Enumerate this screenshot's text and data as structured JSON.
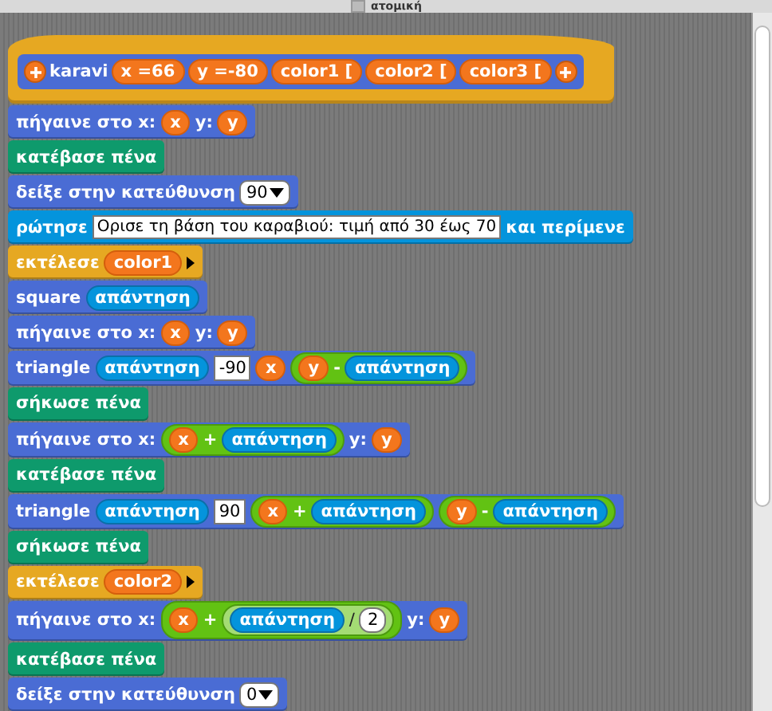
{
  "header": {
    "title": "ατομική"
  },
  "script": {
    "definition": {
      "color": "#e6a822",
      "name": "karavi",
      "params": [
        "x =66",
        "y =-80",
        "color1 [",
        "color2 [",
        "color3 ["
      ]
    },
    "blocks": [
      {
        "color": "#4a6cd4",
        "parts": [
          {
            "kind": "label",
            "text": "πήγαινε στο x:"
          },
          {
            "kind": "var",
            "text": "x"
          },
          {
            "kind": "label",
            "text": "y:"
          },
          {
            "kind": "var",
            "text": "y"
          }
        ]
      },
      {
        "color": "#0e9a6c",
        "parts": [
          {
            "kind": "label",
            "text": "κατέβασε πένα"
          }
        ]
      },
      {
        "color": "#4a6cd4",
        "parts": [
          {
            "kind": "label",
            "text": "δείξε στην κατεύθυνση"
          },
          {
            "kind": "dropdown",
            "text": "90"
          }
        ]
      },
      {
        "color": "#0494dc",
        "parts": [
          {
            "kind": "label",
            "text": "ρώτησε"
          },
          {
            "kind": "text",
            "text": "Ορισε τη βάση του καραβιού: τιμή από 30 έως 70"
          },
          {
            "kind": "label",
            "text": "και περίμενε"
          }
        ]
      },
      {
        "color": "#e6a822",
        "parts": [
          {
            "kind": "label",
            "text": "εκτέλεσε"
          },
          {
            "kind": "var",
            "text": "color1"
          },
          {
            "kind": "arrow"
          }
        ]
      },
      {
        "color": "#4a6cd4",
        "parts": [
          {
            "kind": "label",
            "text": "square"
          },
          {
            "kind": "reporter",
            "text": "απάντηση"
          }
        ]
      },
      {
        "color": "#4a6cd4",
        "parts": [
          {
            "kind": "label",
            "text": "πήγαινε στο x:"
          },
          {
            "kind": "var",
            "text": "x"
          },
          {
            "kind": "label",
            "text": "y:"
          },
          {
            "kind": "var",
            "text": "y"
          }
        ]
      },
      {
        "color": "#4a6cd4",
        "parts": [
          {
            "kind": "label",
            "text": "triangle"
          },
          {
            "kind": "reporter",
            "text": "απάντηση"
          },
          {
            "kind": "num",
            "text": "-90"
          },
          {
            "kind": "var",
            "text": "x"
          },
          {
            "kind": "op",
            "color": "#62c213",
            "parts": [
              {
                "kind": "var",
                "text": "y"
              },
              {
                "kind": "label",
                "text": "-"
              },
              {
                "kind": "reporter",
                "text": "απάντηση"
              }
            ]
          }
        ]
      },
      {
        "color": "#0e9a6c",
        "parts": [
          {
            "kind": "label",
            "text": "σήκωσε πένα"
          }
        ]
      },
      {
        "color": "#4a6cd4",
        "parts": [
          {
            "kind": "label",
            "text": "πήγαινε στο x:"
          },
          {
            "kind": "op",
            "color": "#62c213",
            "parts": [
              {
                "kind": "var",
                "text": "x"
              },
              {
                "kind": "label",
                "text": "+"
              },
              {
                "kind": "reporter",
                "text": "απάντηση"
              }
            ]
          },
          {
            "kind": "label",
            "text": "y:"
          },
          {
            "kind": "var",
            "text": "y"
          }
        ]
      },
      {
        "color": "#0e9a6c",
        "parts": [
          {
            "kind": "label",
            "text": "κατέβασε πένα"
          }
        ]
      },
      {
        "color": "#4a6cd4",
        "parts": [
          {
            "kind": "label",
            "text": "triangle"
          },
          {
            "kind": "reporter",
            "text": "απάντηση"
          },
          {
            "kind": "num",
            "text": "90"
          },
          {
            "kind": "op",
            "color": "#62c213",
            "parts": [
              {
                "kind": "var",
                "text": "x"
              },
              {
                "kind": "label",
                "text": "+"
              },
              {
                "kind": "reporter",
                "text": "απάντηση"
              }
            ]
          },
          {
            "kind": "op",
            "color": "#62c213",
            "parts": [
              {
                "kind": "var",
                "text": "y"
              },
              {
                "kind": "label",
                "text": "-"
              },
              {
                "kind": "reporter",
                "text": "απάντηση"
              }
            ]
          }
        ]
      },
      {
        "color": "#0e9a6c",
        "parts": [
          {
            "kind": "label",
            "text": "σήκωσε πένα"
          }
        ]
      },
      {
        "color": "#e6a822",
        "parts": [
          {
            "kind": "label",
            "text": "εκτέλεσε"
          },
          {
            "kind": "var",
            "text": "color2"
          },
          {
            "kind": "arrow"
          }
        ]
      },
      {
        "color": "#4a6cd4",
        "parts": [
          {
            "kind": "label",
            "text": "πήγαινε στο x:"
          },
          {
            "kind": "op",
            "color": "#62c213",
            "parts": [
              {
                "kind": "var",
                "text": "x"
              },
              {
                "kind": "label",
                "text": "+"
              },
              {
                "kind": "op",
                "color": "#a4dc74",
                "parts": [
                  {
                    "kind": "reporter",
                    "text": "απάντηση"
                  },
                  {
                    "kind": "dark",
                    "text": "/"
                  },
                  {
                    "kind": "round",
                    "text": "2"
                  }
                ]
              }
            ]
          },
          {
            "kind": "label",
            "text": "y:"
          },
          {
            "kind": "var",
            "text": "y"
          }
        ]
      },
      {
        "color": "#0e9a6c",
        "parts": [
          {
            "kind": "label",
            "text": "κατέβασε πένα"
          }
        ]
      },
      {
        "color": "#4a6cd4",
        "parts": [
          {
            "kind": "label",
            "text": "δείξε στην κατεύθυνση"
          },
          {
            "kind": "dropdown",
            "text": "0"
          }
        ]
      }
    ]
  }
}
